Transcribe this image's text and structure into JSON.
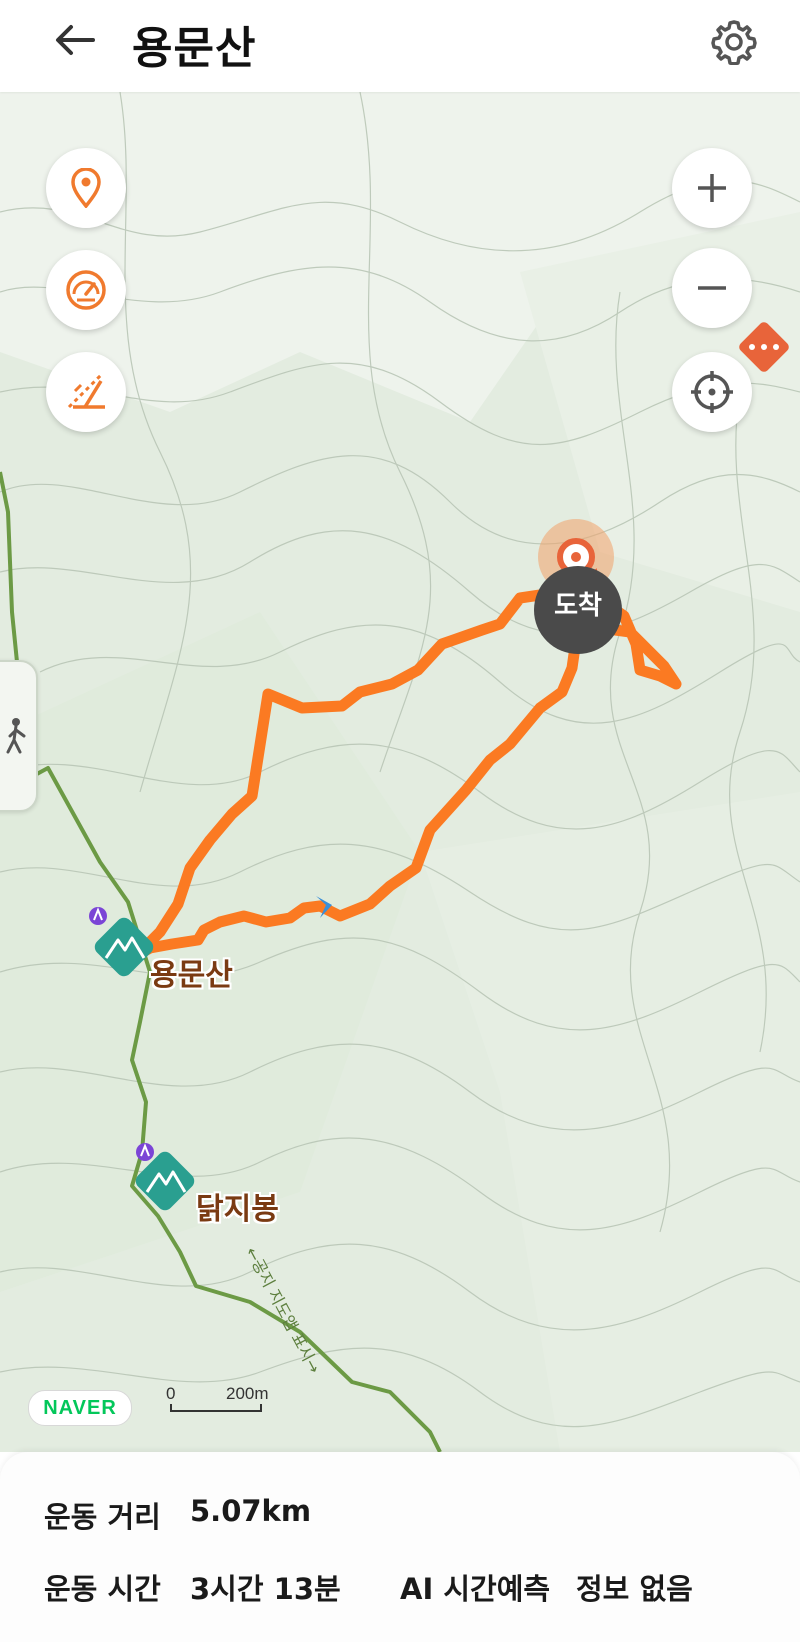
{
  "header": {
    "title": "용문산",
    "back_icon": "back-arrow-icon",
    "settings_icon": "gear-icon"
  },
  "map": {
    "left_controls": [
      {
        "icon": "location-pin-icon"
      },
      {
        "icon": "speedometer-icon"
      },
      {
        "icon": "elevation-slope-icon"
      }
    ],
    "right_controls": [
      {
        "icon": "zoom-in-icon",
        "glyph": "+"
      },
      {
        "icon": "zoom-out-icon",
        "glyph": "−"
      },
      {
        "icon": "crosshair-icon"
      }
    ],
    "more_icon": "more-dots-icon",
    "arrival_label": "도착",
    "pois": [
      {
        "name": "용문산",
        "icon": "mountain-peak-icon"
      },
      {
        "name": "닭지봉",
        "icon": "mountain-peak-icon"
      }
    ],
    "trail_label": "←공지 지도앱 표시→",
    "naver_logo": "NAVER",
    "scale_start": "0",
    "scale_end": "200",
    "scale_unit": "m",
    "colors": {
      "track": "#fb7a22",
      "trail": "#6c9a45",
      "accent": "#e8643a",
      "poi": "#2a9f90",
      "naver": "#03c75a"
    }
  },
  "stats": {
    "distance_label": "운동 거리",
    "distance_value": "5.07km",
    "time_label": "운동 시간",
    "time_value": "3시간 13분",
    "ai_label": "AI 시간예측",
    "ai_value": "정보 없음"
  }
}
